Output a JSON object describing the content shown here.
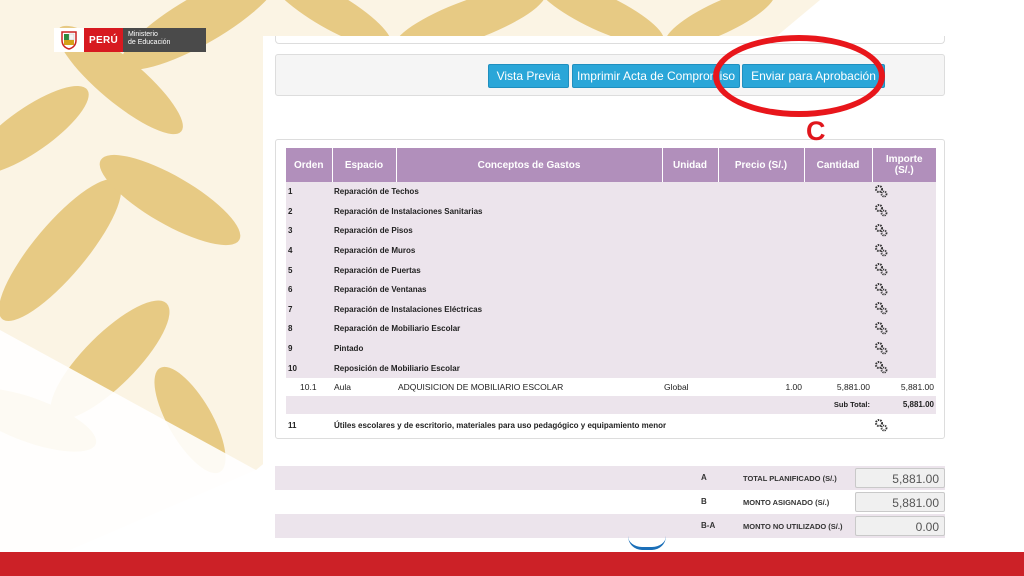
{
  "logo": {
    "country": "PERÚ",
    "ministry_line1": "Ministerio",
    "ministry_line2": "de Educación"
  },
  "buttons": {
    "preview": "Vista Previa",
    "print": "Imprimir Acta de Compromiso",
    "submit": "Enviar para Aprobación"
  },
  "annotation": {
    "letter": "C",
    "color": "#e8161b"
  },
  "table": {
    "headers": {
      "orden": "Orden",
      "espacio": "Espacio",
      "conceptos": "Conceptos de Gastos",
      "unidad": "Unidad",
      "precio": "Precio (S/.)",
      "cantidad": "Cantidad",
      "importe_1": "Importe",
      "importe_2": "(S/.)"
    },
    "categories": [
      {
        "orden": "1",
        "label": "Reparación de Techos"
      },
      {
        "orden": "2",
        "label": "Reparación de Instalaciones Sanitarias"
      },
      {
        "orden": "3",
        "label": "Reparación de Pisos"
      },
      {
        "orden": "4",
        "label": "Reparación de Muros"
      },
      {
        "orden": "5",
        "label": "Reparación de Puertas"
      },
      {
        "orden": "6",
        "label": "Reparación de Ventanas"
      },
      {
        "orden": "7",
        "label": "Reparación de Instalaciones Eléctricas"
      },
      {
        "orden": "8",
        "label": "Reparación de Mobiliario Escolar"
      },
      {
        "orden": "9",
        "label": "Pintado"
      },
      {
        "orden": "10",
        "label": "Reposición de Mobiliario Escolar"
      }
    ],
    "item": {
      "orden": "10.1",
      "espacio": "Aula",
      "concepto": "ADQUISICION DE MOBILIARIO ESCOLAR",
      "unidad": "Global",
      "precio": "1.00",
      "cantidad": "5,881.00",
      "importe": "5,881.00"
    },
    "subtotal": {
      "label": "Sub Total:",
      "value": "5,881.00"
    },
    "last": {
      "orden": "11",
      "label": "Útiles escolares y de escritorio, materiales para uso pedagógico y equipamiento menor"
    }
  },
  "summary": [
    {
      "code": "A",
      "label": "TOTAL PLANIFICADO  (S/.)",
      "value": "5,881.00"
    },
    {
      "code": "B",
      "label": "MONTO ASIGNADO  (S/.)",
      "value": "5,881.00"
    },
    {
      "code": "B-A",
      "label": "MONTO NO UTILIZADO  (S/.)",
      "value": "0.00"
    }
  ],
  "colors": {
    "header": "#b18fbb",
    "row_shade": "#ece4ec",
    "button": "#2aa6d8",
    "footer": "#cc2127",
    "pattern": "#e0bd6a"
  }
}
